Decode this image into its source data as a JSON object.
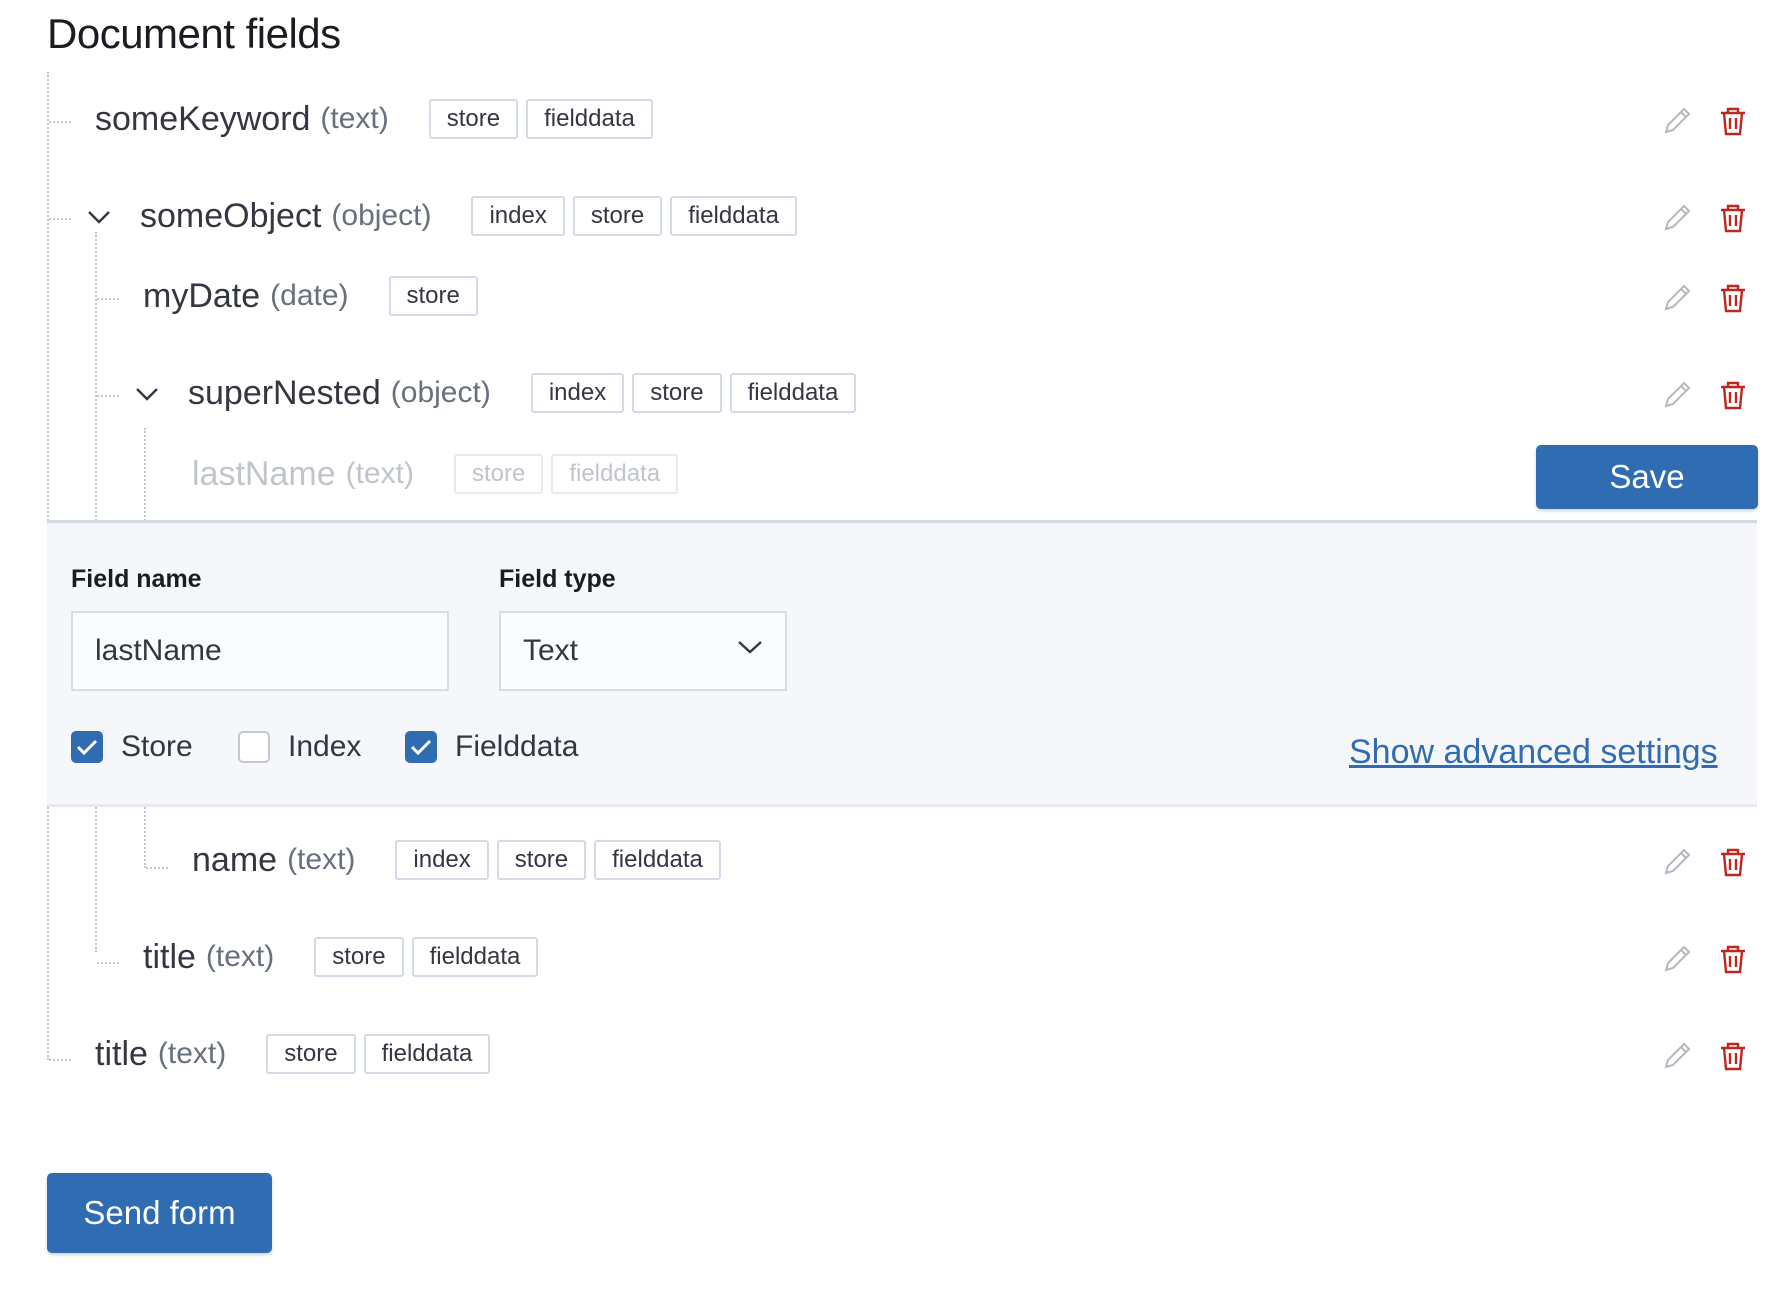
{
  "page": {
    "title": "Document fields"
  },
  "fields": [
    {
      "name": "someKeyword",
      "type": "(text)",
      "badges": [
        "store",
        "fielddata"
      ]
    },
    {
      "name": "someObject",
      "type": "(object)",
      "badges": [
        "index",
        "store",
        "fielddata"
      ]
    },
    {
      "name": "myDate",
      "type": "(date)",
      "badges": [
        "store"
      ]
    },
    {
      "name": "superNested",
      "type": "(object)",
      "badges": [
        "index",
        "store",
        "fielddata"
      ]
    },
    {
      "name": "lastName",
      "type": "(text)",
      "badges": [
        "store",
        "fielddata"
      ]
    },
    {
      "name": "name",
      "type": "(text)",
      "badges": [
        "index",
        "store",
        "fielddata"
      ]
    },
    {
      "name": "title",
      "type": "(text)",
      "badges": [
        "store",
        "fielddata"
      ]
    },
    {
      "name": "title",
      "type": "(text)",
      "badges": [
        "store",
        "fielddata"
      ]
    }
  ],
  "editor": {
    "save_label": "Save",
    "field_name_label": "Field name",
    "field_name_value": "lastName",
    "field_type_label": "Field type",
    "field_type_value": "Text",
    "checkboxes": [
      {
        "label": "Store",
        "checked": true
      },
      {
        "label": "Index",
        "checked": false
      },
      {
        "label": "Fielddata",
        "checked": true
      }
    ],
    "advanced_link": "Show advanced settings"
  },
  "footer": {
    "send_label": "Send form"
  },
  "colors": {
    "primary": "#2f6cb1",
    "danger": "#bd271e",
    "muted": "#69707d"
  },
  "icons": {
    "edit": "pencil-icon",
    "delete": "trash-icon",
    "expand": "chevron-down-icon"
  }
}
